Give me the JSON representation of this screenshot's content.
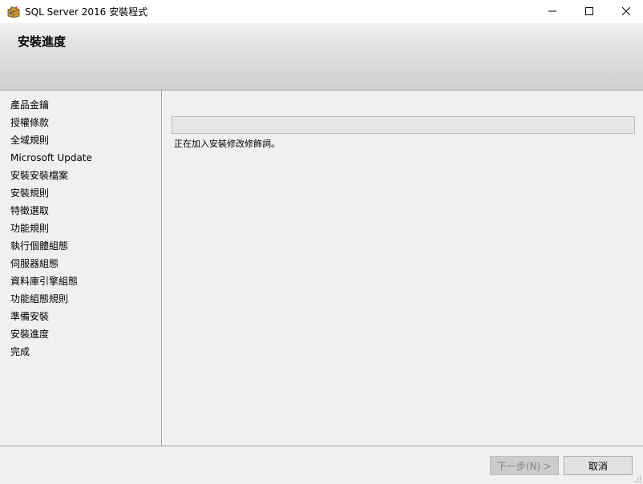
{
  "window": {
    "title": "SQL Server 2016 安裝程式",
    "icon": "installer-box-icon",
    "controls": [
      "minimize-icon",
      "maximize-icon",
      "close-icon"
    ]
  },
  "header": {
    "title": "安裝進度"
  },
  "sidebar": {
    "items": [
      {
        "label": "產品金鑰"
      },
      {
        "label": "授權條款"
      },
      {
        "label": "全域規則"
      },
      {
        "label": "Microsoft Update"
      },
      {
        "label": "安裝安裝檔案"
      },
      {
        "label": "安裝規則"
      },
      {
        "label": "特徵選取"
      },
      {
        "label": "功能規則"
      },
      {
        "label": "執行個體組態"
      },
      {
        "label": "伺服器組態"
      },
      {
        "label": "資料庫引擎組態"
      },
      {
        "label": "功能組態規則"
      },
      {
        "label": "準備安裝"
      },
      {
        "label": "安裝進度"
      },
      {
        "label": "完成"
      }
    ],
    "current_index": 13
  },
  "main": {
    "progress": 0,
    "status_text": "正在加入安裝修改修飾詞。"
  },
  "footer": {
    "next_label": "下一步(N) >",
    "cancel_label": "取消"
  },
  "colors": {
    "progress_fill": "#06b025",
    "panel_bg": "#f0f0f0"
  }
}
